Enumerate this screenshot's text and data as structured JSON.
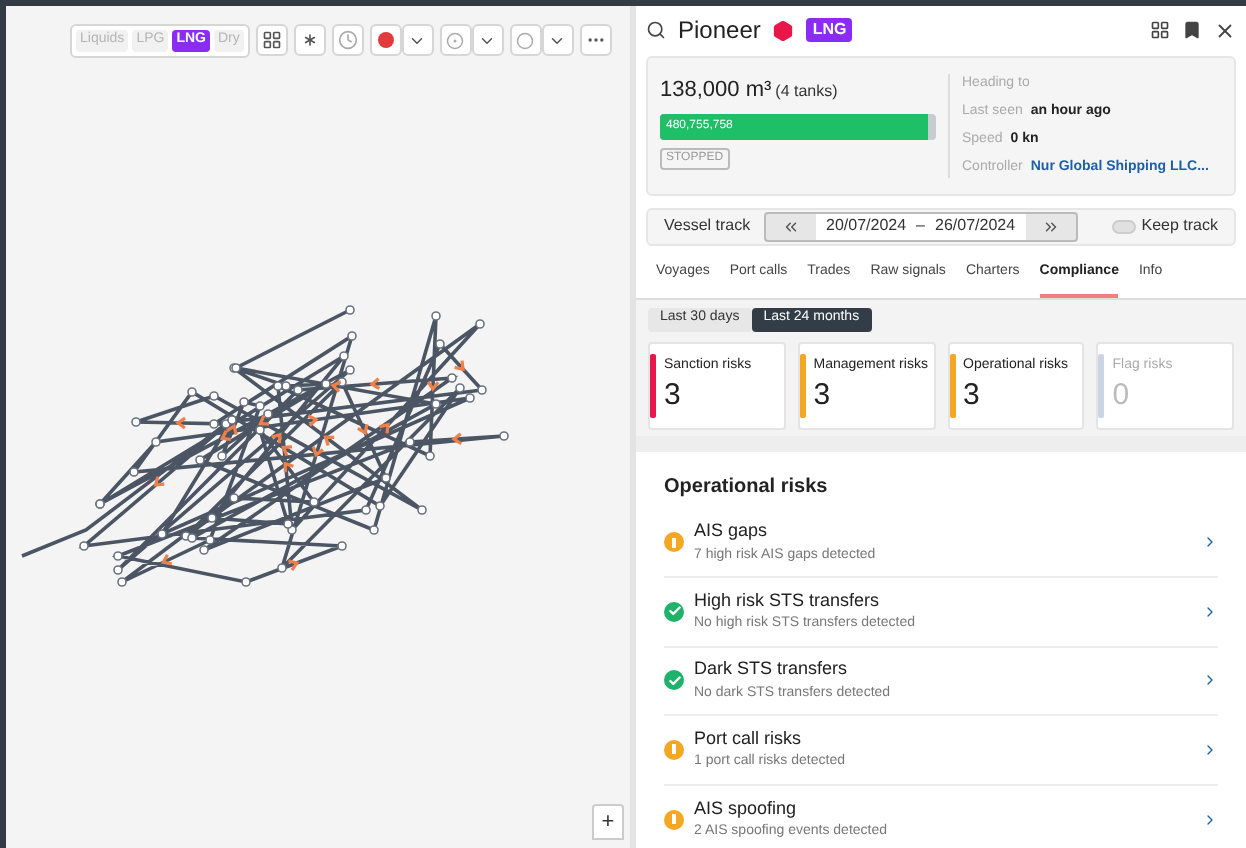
{
  "map": {
    "cargo_filters": [
      {
        "label": "Liquids",
        "selected": false
      },
      {
        "label": "LPG",
        "selected": false
      },
      {
        "label": "LNG",
        "selected": true
      },
      {
        "label": "Dry",
        "selected": false
      }
    ],
    "zoom_in": "+"
  },
  "vessel": {
    "name": "Pioneer",
    "type_badge": "LNG",
    "capacity": "138,000 m³",
    "tanks": "(4 tanks)",
    "fill_bar": {
      "reading": "480,755,758",
      "level": 0.97
    },
    "status": "STOPPED",
    "details": [
      {
        "label": "Heading to"
      },
      {
        "label": "Last seen",
        "value": "an hour ago"
      },
      {
        "label": "Speed",
        "value": "0 kn"
      }
    ],
    "controller": {
      "label": "Controller",
      "value": "Nur Global Shipping LLC..."
    }
  },
  "vessel_track": {
    "label": "Vessel track",
    "date_from": "20/07/2024",
    "separator": "–",
    "date_to": "26/07/2024",
    "keep_track": {
      "label": "Keep track",
      "on": false
    }
  },
  "tabs": [
    {
      "label": "Voyages",
      "selected": false
    },
    {
      "label": "Port calls",
      "selected": false
    },
    {
      "label": "Trades",
      "selected": false
    },
    {
      "label": "Raw signals",
      "selected": false
    },
    {
      "label": "Charters",
      "selected": false
    },
    {
      "label": "Compliance",
      "selected": true
    },
    {
      "label": "Info",
      "selected": false
    }
  ],
  "periods": [
    {
      "label": "Last 30 days",
      "selected": false
    },
    {
      "label": "Last 24 months",
      "selected": true
    }
  ],
  "risk_cards": [
    {
      "label": "Sanction risks",
      "count": "3",
      "color": "#e8174a",
      "disabled": false
    },
    {
      "label": "Management risks",
      "count": "3",
      "color": "#f5a623",
      "disabled": false
    },
    {
      "label": "Operational risks",
      "count": "3",
      "color": "#f5a623",
      "disabled": false
    },
    {
      "label": "Flag risks",
      "count": "0",
      "color": "#cbd5e1",
      "disabled": true
    }
  ],
  "operational_risks": {
    "title": "Operational risks",
    "items": [
      {
        "title": "AIS gaps",
        "detail": "7 high risk AIS gaps detected",
        "kind": "warning"
      },
      {
        "title": "High risk STS transfers",
        "detail": "No high risk STS transfers detected",
        "kind": "ok"
      },
      {
        "title": "Dark STS transfers",
        "detail": "No dark STS transfers detected",
        "kind": "ok"
      },
      {
        "title": "Port call risks",
        "detail": "1 port call risks detected",
        "kind": "warning"
      },
      {
        "title": "AIS spoofing",
        "detail": "2 AIS spoofing events detected",
        "kind": "warning"
      }
    ]
  }
}
